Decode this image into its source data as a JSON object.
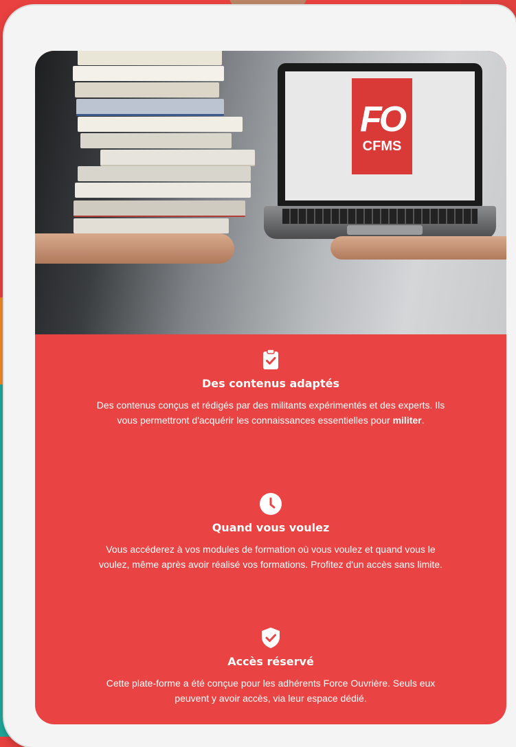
{
  "logo": {
    "line1": "FO",
    "line2": "CFMS"
  },
  "features": [
    {
      "icon": "clipboard-check-icon",
      "title": "Des contenus adaptés",
      "text_before": "Des contenus conçus et rédigés par des militants expérimentés et des experts. Ils vous permettront d'acquérir les connaissances essentielles pour ",
      "text_bold": "militer",
      "text_after": "."
    },
    {
      "icon": "clock-icon",
      "title": "Quand vous voulez",
      "text": "Vous accéderez à vos modules de formation où vous voulez et quand vous le voulez, même après avoir réalisé vos formations. Profitez d'un accès sans limite."
    },
    {
      "icon": "shield-check-icon",
      "title": "Accès réservé",
      "text": "Cette plate-forme a été conçue pour les adhérents Force Ouvrière. Seuls eux peuvent y avoir accès, via leur espace dédié."
    }
  ],
  "colors": {
    "accent": "#e94443",
    "orange": "#f08a24",
    "teal": "#1fa89a",
    "logo_red": "#d93a38"
  }
}
